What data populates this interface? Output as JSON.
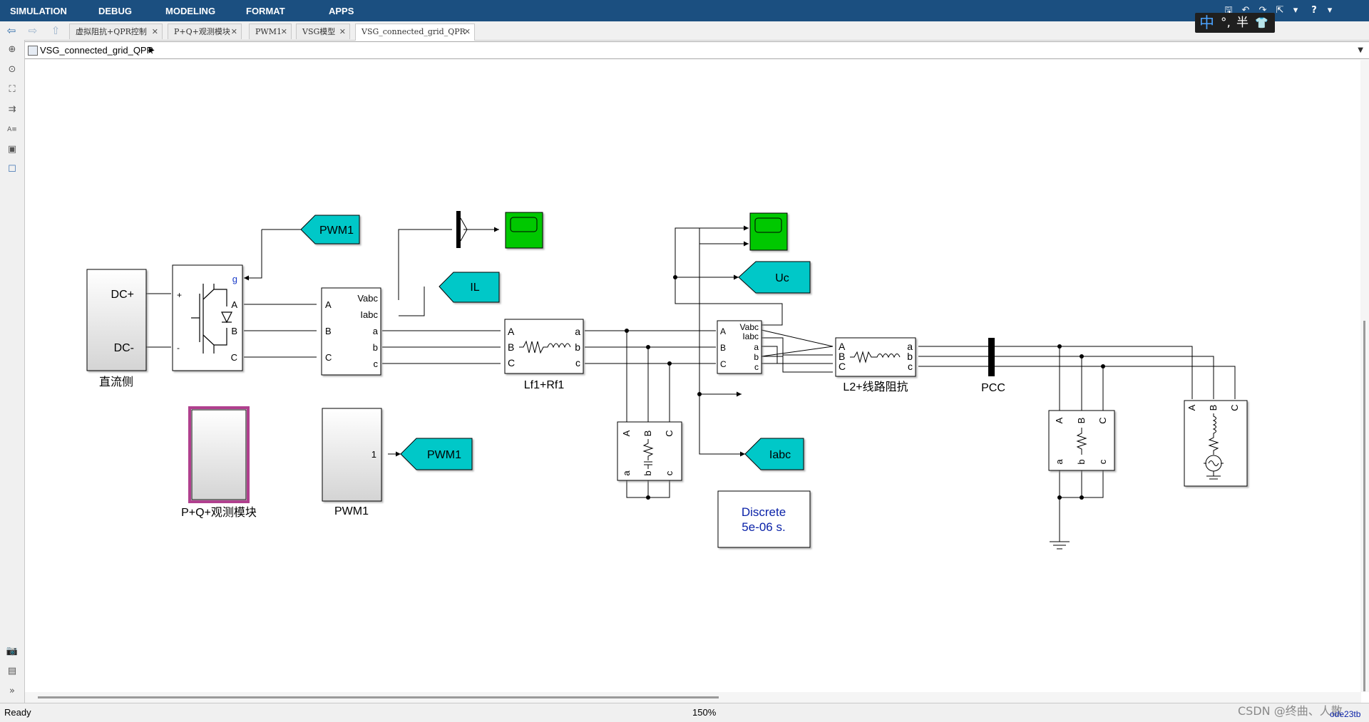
{
  "menu": [
    "SIMULATION",
    "DEBUG",
    "MODELING",
    "FORMAT",
    "APPS"
  ],
  "quick_toolbar": {
    "save": "🖫",
    "undo": "↶",
    "redo": "↷",
    "more": "⇱",
    "caret1": "▾",
    "help": "?",
    "caret2": "▾"
  },
  "ime_bar": {
    "mode": "中",
    "punct": "°,",
    "width": "半",
    "skin": "👕"
  },
  "tabs": [
    {
      "label": "虚拟阻抗+QPR控制",
      "active": false
    },
    {
      "label": "P+Q+观测模块",
      "active": false
    },
    {
      "label": "PWM1",
      "active": false
    },
    {
      "label": "VSG模型",
      "active": false
    },
    {
      "label": "VSG_connected_grid_QPR",
      "active": true
    }
  ],
  "tab_close_glyph": "✕",
  "nav": {
    "back": "⇦",
    "forward": "⇨",
    "up": "⇧"
  },
  "breadcrumb": {
    "model": "VSG_connected_grid_QPR",
    "arrow": "▶",
    "dropdown": "▼"
  },
  "left_toolbar": [
    "⊕",
    "⊙",
    "⛶",
    "⇉",
    "A≡",
    "▣",
    "☐",
    "📷",
    "▤",
    "»"
  ],
  "diagram": {
    "dc_source": {
      "plus": "DC+",
      "minus": "DC-",
      "name": "直流侧",
      "port_plus": "+",
      "port_minus": "-"
    },
    "converter": {
      "gate": "g",
      "A": "A",
      "B": "B",
      "C": "C"
    },
    "vi_meas_1": {
      "in": [
        "A",
        "B",
        "C"
      ],
      "out_meas": [
        "Vabc",
        "Iabc"
      ],
      "out": [
        "a",
        "b",
        "c"
      ]
    },
    "goto_pwm1_top": "PWM1",
    "goto_il": "IL",
    "goto_uc": "Uc",
    "goto_iabc": "Iabc",
    "goto_pwm1_bottom": "PWM1",
    "filter1": {
      "in": [
        "A",
        "B",
        "C"
      ],
      "out": [
        "a",
        "b",
        "c"
      ],
      "name": "Lf1+Rf1"
    },
    "vi_meas_2": {
      "in": [
        "A",
        "B",
        "C"
      ],
      "out_meas": [
        "Vabc",
        "Iabc"
      ],
      "out": [
        "a",
        "b",
        "c"
      ]
    },
    "line2": {
      "in": [
        "A",
        "B",
        "C"
      ],
      "out": [
        "a",
        "b",
        "c"
      ],
      "name": "L2+线路阻抗"
    },
    "pcc": {
      "name": "PCC"
    },
    "cap_load": {
      "top": [
        "A",
        "B",
        "C"
      ],
      "bottom": [
        "a",
        "b",
        "c"
      ]
    },
    "res_load": {
      "top": [
        "A",
        "B",
        "C"
      ],
      "bottom": [
        "a",
        "b",
        "c"
      ]
    },
    "grid_source": {
      "ports": [
        "A",
        "B",
        "C"
      ]
    },
    "pq_block": {
      "name": "P+Q+观测模块"
    },
    "pwm_block": {
      "port": "1",
      "name": "PWM1"
    },
    "powergui": {
      "line1": "Discrete",
      "line2": "5e-06 s."
    }
  },
  "status": {
    "text": "Ready",
    "zoom": "150%",
    "watermark": "CSDN @终曲、人散",
    "solver": "ode23tb"
  },
  "colors": {
    "menubar": "#1b4f80",
    "scope": "#00c800",
    "goto": "#00c8c8",
    "selection": "#b0408e",
    "powergui_text": "#0a22a8"
  }
}
